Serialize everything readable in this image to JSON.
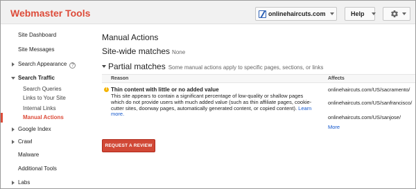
{
  "header": {
    "app_title": "Webmaster Tools",
    "site_selector": "onlinehaircuts.com",
    "help_label": "Help",
    "settings_icon": "gear-icon",
    "background": "#f1f1f1",
    "brand_color": "#dd4b39"
  },
  "sidebar": {
    "items": [
      {
        "label": "Site Dashboard"
      },
      {
        "label": "Site Messages"
      },
      {
        "label": "Search Appearance"
      },
      {
        "label": "Search Traffic"
      },
      {
        "label": "Search Queries"
      },
      {
        "label": "Links to Your Site"
      },
      {
        "label": "Internal Links"
      },
      {
        "label": "Manual Actions"
      },
      {
        "label": "Google Index"
      },
      {
        "label": "Crawl"
      },
      {
        "label": "Malware"
      },
      {
        "label": "Additional Tools"
      },
      {
        "label": "Labs"
      }
    ],
    "help_glyph": "?",
    "active_item": "Manual Actions"
  },
  "main": {
    "page_title": "Manual Actions",
    "sitewide_heading": "Site-wide matches",
    "sitewide_value": "None",
    "partial_heading": "Partial matches",
    "partial_description": "Some manual actions apply to specific pages, sections, or links",
    "table": {
      "columns": [
        "Reason",
        "Affects"
      ],
      "rows": [
        {
          "reason_title": "Thin content with little or no added value",
          "reason_body": "This site appears to contain a significant percentage of low-quality or shallow pages which do not provide users with much added value (such as thin affiliate pages, cookie-cutter sites, doorway pages, automatically generated content, or copied content).",
          "learn_more": "Learn more.",
          "affects": [
            "onlinehaircuts.com/US/sacramento/",
            "onlinehaircuts.com/US/sanfrancisco/",
            "onlinehaircuts.com/US/sanjose/"
          ],
          "more_link": "More"
        }
      ]
    },
    "request_button": "REQUEST A REVIEW",
    "request_button_color": "#d14836",
    "warning_glyph": "!"
  }
}
